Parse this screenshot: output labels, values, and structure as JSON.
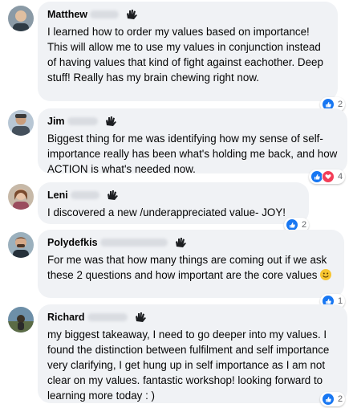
{
  "comments": [
    {
      "name": "Matthew",
      "text": "I learned how to order my values based on importance! This will allow me to use my values in conjunction instead of having values that kind of fight against eachother. Deep stuff! Really has my brain chewing right now.",
      "reaction_count": "2"
    },
    {
      "name": "Jim",
      "text": "Biggest thing for me was identifying how my sense of self-importance really has been what's holding me back, and how ACTION is what's needed now.",
      "reaction_count": "4"
    },
    {
      "name": "Leni",
      "text": "I discovered a new /underappreciated value- JOY!",
      "reaction_count": "2"
    },
    {
      "name": "Polydefkis",
      "text": "For me was that how many things are coming out if we ask these 2 questions and how important are the core values",
      "reaction_count": "1"
    },
    {
      "name": "Richard",
      "text": "my biggest takeaway, I need to go deeper into my values. I found the distinction between fulfilment and self importance very clarifying, I get hung up in self importance as I am not clear on my values. fantastic workshop! looking forward to learning more today : )",
      "reaction_count": "2"
    }
  ],
  "colors": {
    "bubble": "#f0f2f5",
    "like": "#1877f2",
    "love": "#f33e58",
    "meta": "#65676b"
  },
  "icons": {
    "wave": "waving-hand-icon",
    "like": "like-icon",
    "love": "love-icon",
    "emoji": "smiley-emoji"
  }
}
